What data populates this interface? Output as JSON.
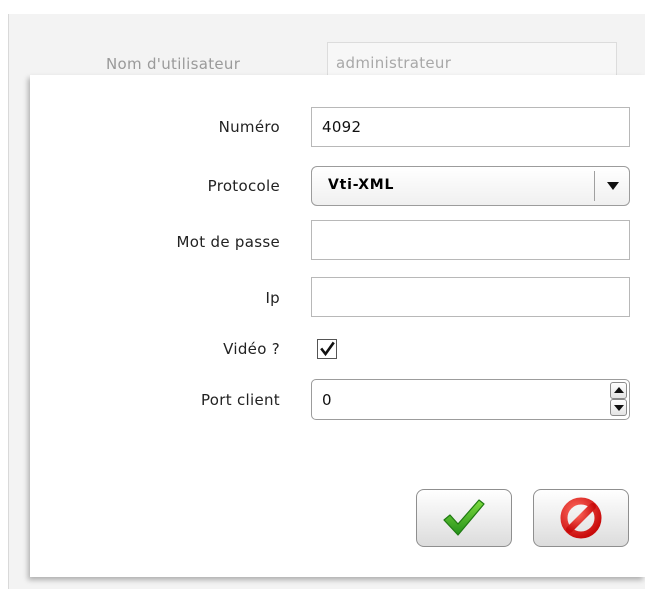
{
  "background": {
    "username_label": "Nom d'utilisateur",
    "username_value": "administrateur"
  },
  "dialog": {
    "numero_label": "Numéro",
    "numero_value": "4092",
    "protocole_label": "Protocole",
    "protocole_value": "Vti-XML",
    "password_label": "Mot de passe",
    "password_value": "",
    "ip_label": "Ip",
    "ip_value": "",
    "video_label": "Vidéo ?",
    "video_checked": true,
    "port_label": "Port client",
    "port_value": "0"
  },
  "buttons": {
    "ok_icon": "green-checkmark-icon",
    "cancel_icon": "red-forbidden-icon"
  },
  "colors": {
    "ok_green": "#3fae1f",
    "cancel_red": "#d90f0f"
  }
}
